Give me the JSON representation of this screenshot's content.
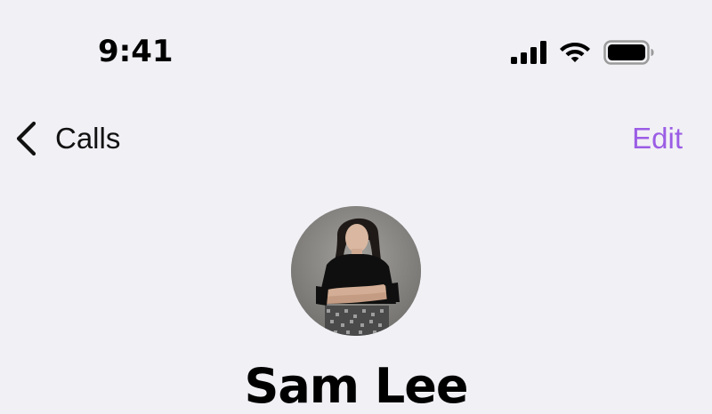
{
  "status_bar": {
    "time": "9:41",
    "icons": [
      "signal-icon",
      "wifi-icon",
      "battery-icon"
    ]
  },
  "nav": {
    "back_label": "Calls",
    "edit_label": "Edit",
    "back_icon": "chevron-left-icon"
  },
  "contact": {
    "name": "Sam Lee",
    "avatar": "avatar-photo"
  },
  "colors": {
    "background": "#f1f0f5",
    "accent": "#9b5de5",
    "text": "#000000"
  }
}
